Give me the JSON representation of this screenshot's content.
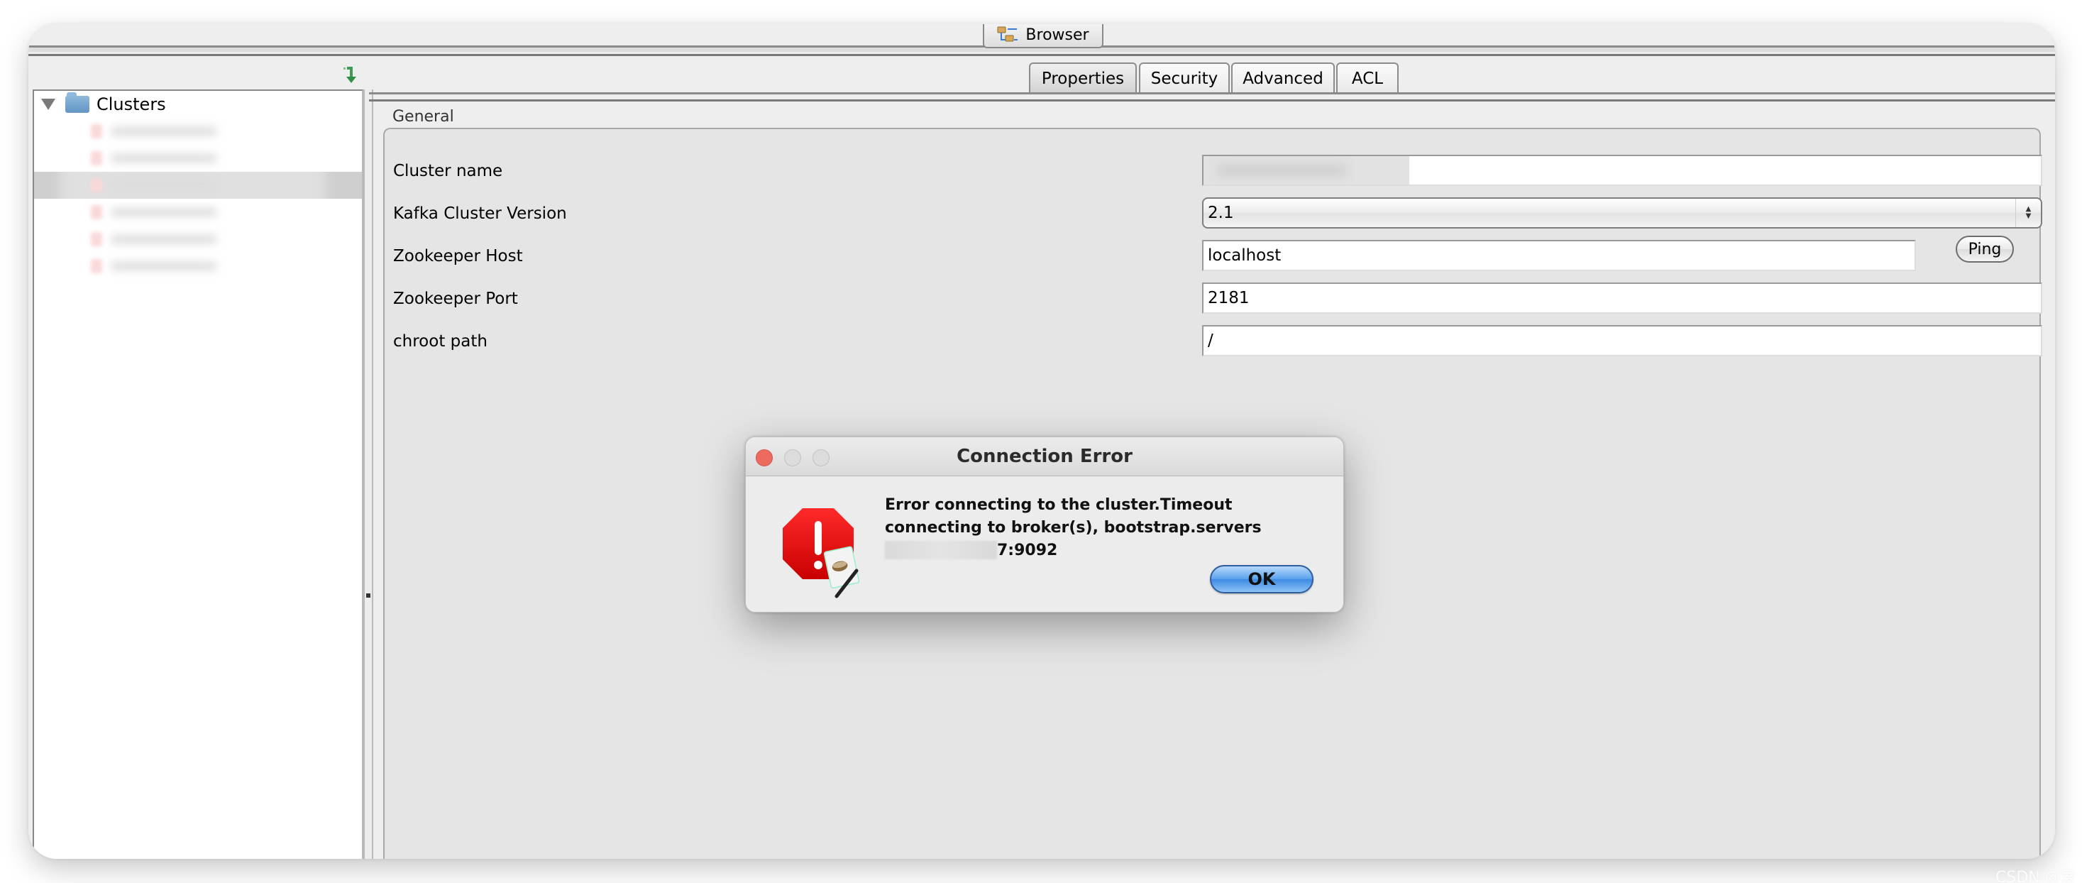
{
  "window": {
    "top_tab": {
      "label": "Browser",
      "icon": "hierarchy-folders-icon"
    }
  },
  "left_panel": {
    "refresh_icon": "green-down-arrow-icon",
    "tree": {
      "root": {
        "label": "Clusters",
        "expanded": true,
        "icon": "folder-icon"
      },
      "items": [
        {
          "label": "[redacted]",
          "selected": false
        },
        {
          "label": "[redacted]",
          "selected": false
        },
        {
          "label": "[redacted]",
          "selected": true
        },
        {
          "label": "[redacted]",
          "selected": false
        },
        {
          "label": "[redacted]",
          "selected": false
        },
        {
          "label": "[redacted]",
          "selected": false
        }
      ]
    }
  },
  "right_panel": {
    "tabs": [
      {
        "label": "Properties",
        "active": true
      },
      {
        "label": "Security",
        "active": false
      },
      {
        "label": "Advanced",
        "active": false
      },
      {
        "label": "ACL",
        "active": false
      }
    ],
    "group_title": "General",
    "fields": {
      "cluster_name": {
        "label": "Cluster name",
        "value": "[redacted]"
      },
      "kafka_version": {
        "label": "Kafka Cluster Version",
        "value": "2.1"
      },
      "zookeeper_host": {
        "label": "Zookeeper Host",
        "value": "localhost"
      },
      "zookeeper_port": {
        "label": "Zookeeper Port",
        "value": "2181"
      },
      "chroot_path": {
        "label": "chroot path",
        "value": "/"
      }
    },
    "ping_label": "Ping"
  },
  "dialog": {
    "title": "Connection Error",
    "message_part1": "Error connecting to the cluster.Timeout connecting to broker(s), bootstrap.servers",
    "message_redacted": "[redacted]",
    "message_part2": "7:9092",
    "ok_label": "OK",
    "icon": "stop-error-icon",
    "colors": {
      "close": "#ec6a5e",
      "ok_button": "#4a90e6",
      "error_red": "#e00000"
    }
  },
  "watermark": "CSDN @爱"
}
